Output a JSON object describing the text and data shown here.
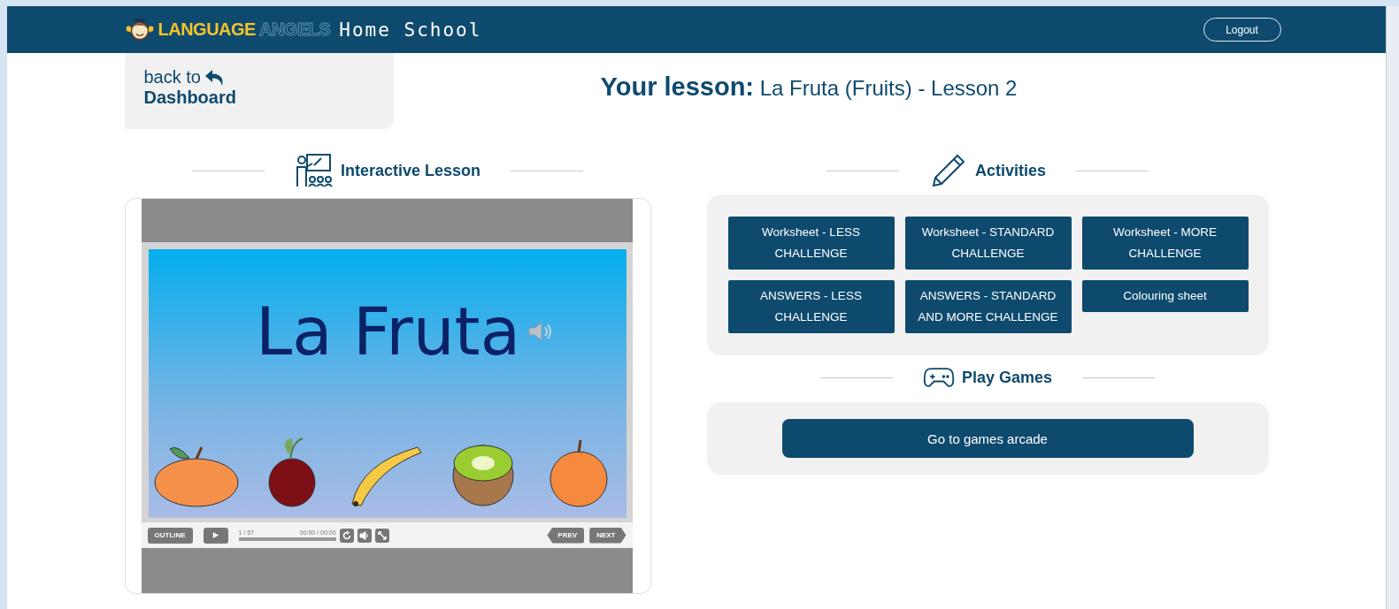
{
  "header": {
    "logo_primary": "LANGUAGE",
    "logo_secondary": "ANGELS",
    "logo_tagline": "Home School",
    "logout": "Logout"
  },
  "back_link": {
    "prefix": "back to",
    "label": "Dashboard"
  },
  "lesson": {
    "heading": "Your lesson:",
    "title": "La Fruta (Fruits) - Lesson 2"
  },
  "interactive_lesson": {
    "heading": "Interactive Lesson",
    "slide_title": "La Fruta",
    "player": {
      "outline": "OUTLINE",
      "slide_counter": "1 / 57",
      "time": "00:00 / 00:00",
      "progress": {
        "level": 0
      },
      "prev": "PREV",
      "next": "NEXT"
    }
  },
  "activities": {
    "heading": "Activities",
    "buttons": [
      {
        "label": "Worksheet - LESS CHALLENGE"
      },
      {
        "label": "Worksheet - STANDARD CHALLENGE"
      },
      {
        "label": "Worksheet - MORE CHALLENGE"
      },
      {
        "label": "ANSWERS - LESS CHALLENGE"
      },
      {
        "label": "ANSWERS - STANDARD AND MORE CHALLENGE"
      },
      {
        "label": "Colouring sheet"
      }
    ]
  },
  "games": {
    "heading": "Play Games",
    "button": "Go to games arcade"
  }
}
